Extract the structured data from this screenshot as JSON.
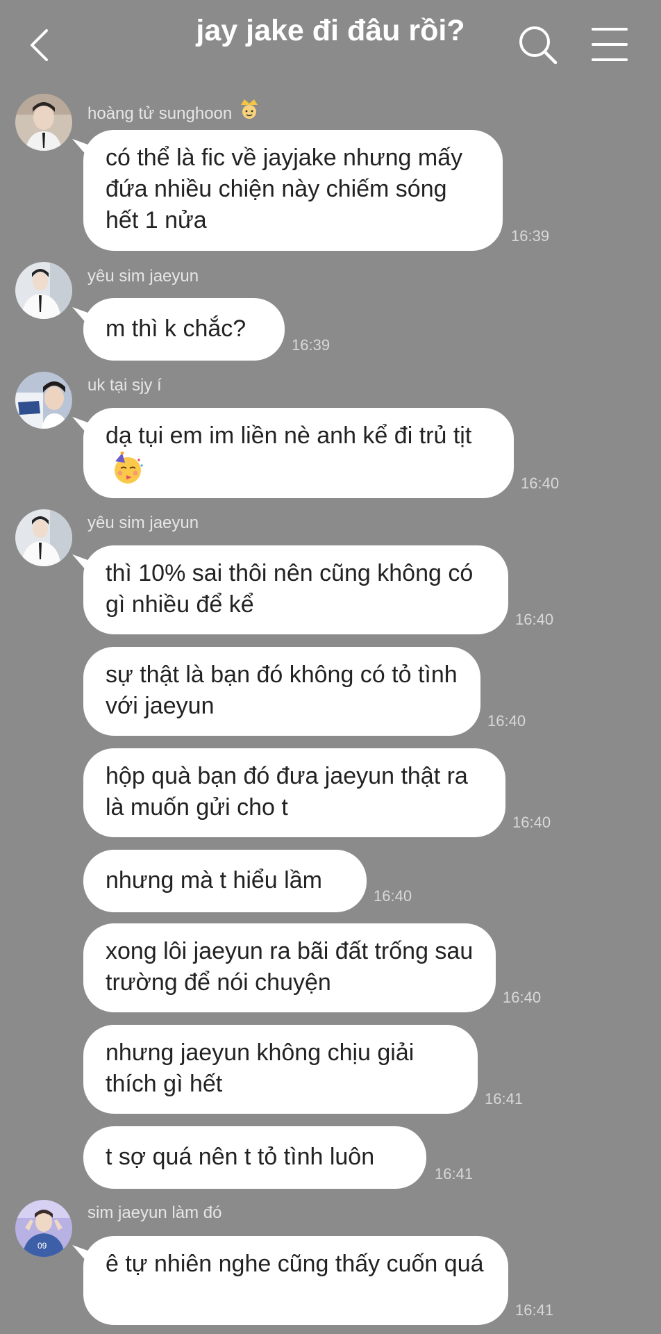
{
  "header": {
    "title": "jay jake đi đâu rồi?",
    "icons": [
      "chevron-left-icon",
      "search-icon",
      "menu-icon"
    ]
  },
  "colors": {
    "background": "#8b8b8b",
    "bubble": "#ffffff",
    "text": "#222222",
    "meta": "#e6e6e6"
  },
  "messages": [
    {
      "sender": "hoàng tử sunghoon",
      "sender_emoji": "prince-emoji",
      "text": "có thể là fic về jayjake nhưng mấy đứa nhiều chiện này chiếm sóng hết 1 nửa",
      "time": "16:39"
    },
    {
      "sender": "yêu sim jaeyun",
      "text": "m thì k chắc?",
      "time": "16:39"
    },
    {
      "sender": "uk tại sjy í",
      "text": "dạ tụi em im liền nè anh kể đi trủ tịt",
      "text_emoji": "partying-face-emoji",
      "time": "16:40"
    },
    {
      "sender": "yêu sim jaeyun",
      "text": "thì 10% sai thôi nên cũng không có gì nhiều để kể",
      "time": "16:40"
    },
    {
      "text": "sự thật là bạn đó không có tỏ tình với jaeyun",
      "time": "16:40"
    },
    {
      "text": "hộp quà bạn đó đưa jaeyun thật ra là muốn gửi cho t",
      "time": "16:40"
    },
    {
      "text": "nhưng mà t hiểu lầm",
      "time": "16:40"
    },
    {
      "text": "xong lôi jaeyun ra bãi đất trống sau trường để nói chuyện",
      "time": "16:40"
    },
    {
      "text": "nhưng jaeyun không chịu giải thích gì hết",
      "time": "16:41"
    },
    {
      "text": "t sợ quá nên t tỏ tình luôn",
      "time": "16:41"
    },
    {
      "sender": "sim jaeyun làm đó",
      "text": "ê tự nhiên nghe cũng thấy cuốn quá",
      "time": "16:41"
    }
  ]
}
